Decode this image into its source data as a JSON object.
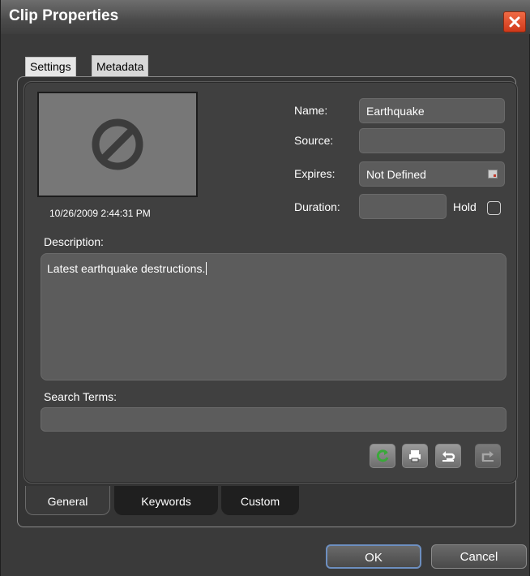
{
  "window": {
    "title": "Clip Properties"
  },
  "top_tabs": [
    {
      "label": "Settings"
    },
    {
      "label": "Metadata"
    }
  ],
  "thumbnail": {
    "timestamp": "10/26/2009 2:44:31 PM",
    "icon": "no-symbol-icon"
  },
  "fields": {
    "name_label": "Name:",
    "name_value": "Earthquake",
    "source_label": "Source:",
    "source_value": "",
    "expires_label": "Expires:",
    "expires_value": "Not Defined",
    "duration_label": "Duration:",
    "duration_value": "",
    "hold_label": "Hold",
    "hold_checked": false
  },
  "description": {
    "label": "Description:",
    "value": "Latest earthquake destructions."
  },
  "search_terms": {
    "label": "Search Terms:",
    "value": ""
  },
  "tools": [
    {
      "icon": "refresh-icon"
    },
    {
      "icon": "print-icon"
    },
    {
      "icon": "undo-icon"
    },
    {
      "icon": "export-icon"
    }
  ],
  "bottom_tabs": [
    {
      "label": "General"
    },
    {
      "label": "Keywords"
    },
    {
      "label": "Custom"
    }
  ],
  "buttons": {
    "ok": "OK",
    "cancel": "Cancel"
  },
  "colors": {
    "close_button": "#e0502c",
    "refresh_green": "#3aa83a",
    "ok_focus_border": "#6d8fc0"
  }
}
